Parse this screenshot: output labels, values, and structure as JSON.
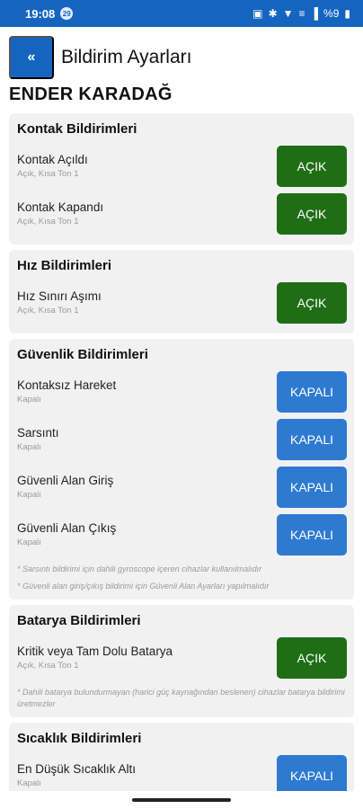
{
  "status_bar": {
    "time": "19:08",
    "indicator": "29",
    "battery": "%9"
  },
  "header": {
    "back_label": "«",
    "title": "Bildirim Ayarları"
  },
  "user_name": "ENDER KARADAĞ",
  "sections": [
    {
      "title": "Kontak Bildirimleri",
      "items": [
        {
          "label": "Kontak Açıldı",
          "sub": "Açık, Kısa Ton 1",
          "state": "AÇIK"
        },
        {
          "label": "Kontak Kapandı",
          "sub": "Açık, Kısa Ton 1",
          "state": "AÇIK"
        }
      ]
    },
    {
      "title": "Hız Bildirimleri",
      "items": [
        {
          "label": "Hız Sınırı Aşımı",
          "sub": "Açık, Kısa Ton 1",
          "state": "AÇIK"
        }
      ]
    },
    {
      "title": "Güvenlik Bildirimleri",
      "items": [
        {
          "label": "Kontaksız Hareket",
          "sub": "Kapalı",
          "state": "KAPALI"
        },
        {
          "label": "Sarsıntı",
          "sub": "Kapalı",
          "state": "KAPALI"
        },
        {
          "label": "Güvenli Alan Giriş",
          "sub": "Kapalı",
          "state": "KAPALI"
        },
        {
          "label": "Güvenli Alan Çıkış",
          "sub": "Kapalı",
          "state": "KAPALI"
        }
      ],
      "notes": [
        "* Sarsıntı bildirimi için dahili gyroscope içeren cihazlar kullanılmalıdır",
        "* Güvenli alan giriş/çıkış bildirimi için Güvenli Alan Ayarları yapılmalıdır"
      ]
    },
    {
      "title": "Batarya Bildirimleri",
      "items": [
        {
          "label": "Kritik veya Tam Dolu Batarya",
          "sub": "Açık, Kısa Ton 1",
          "state": "AÇIK"
        }
      ],
      "notes": [
        "* Dahili batarya bulundurmayan (harici güç kaynağından beslenen) cihazlar batarya bildirimi üretmezler"
      ]
    },
    {
      "title": "Sıcaklık Bildirimleri",
      "items": [
        {
          "label": "En Düşük Sıcaklık Altı",
          "sub": "Kapalı",
          "state": "KAPALI"
        }
      ]
    }
  ],
  "colors": {
    "primary": "#1565c0",
    "on": "#1f6e16",
    "off": "#2e7ad1",
    "card": "#f1f1f1"
  }
}
